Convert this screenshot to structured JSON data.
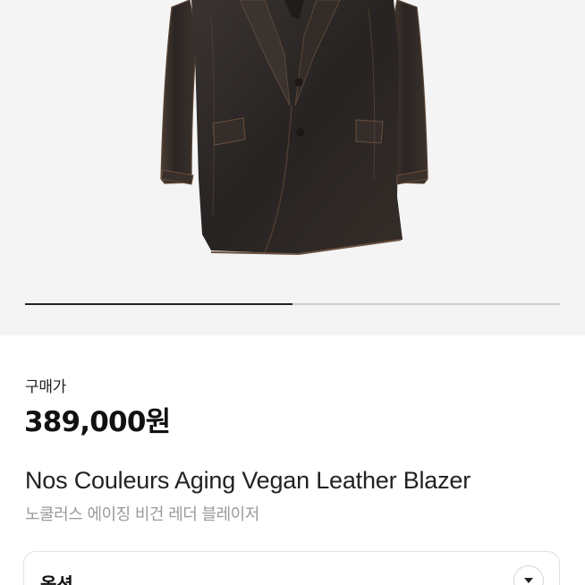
{
  "gallery": {
    "image_alt_icon": "leather-blazer-photo",
    "progress_fraction": 0.5
  },
  "price": {
    "label": "구매가",
    "value": "389,000원"
  },
  "product": {
    "name_en": "Nos Couleurs Aging Vegan Leather Blazer",
    "name_ko": "노쿨러스 에이징 비건 레더 블레이저"
  },
  "option": {
    "label": "옵션",
    "toggle_icon": "chevron-down-icon"
  },
  "colors": {
    "image_bg": "#f4f4f4",
    "blazer": "#2b2725",
    "text_primary": "#111111",
    "text_secondary": "#9a9a9a"
  }
}
